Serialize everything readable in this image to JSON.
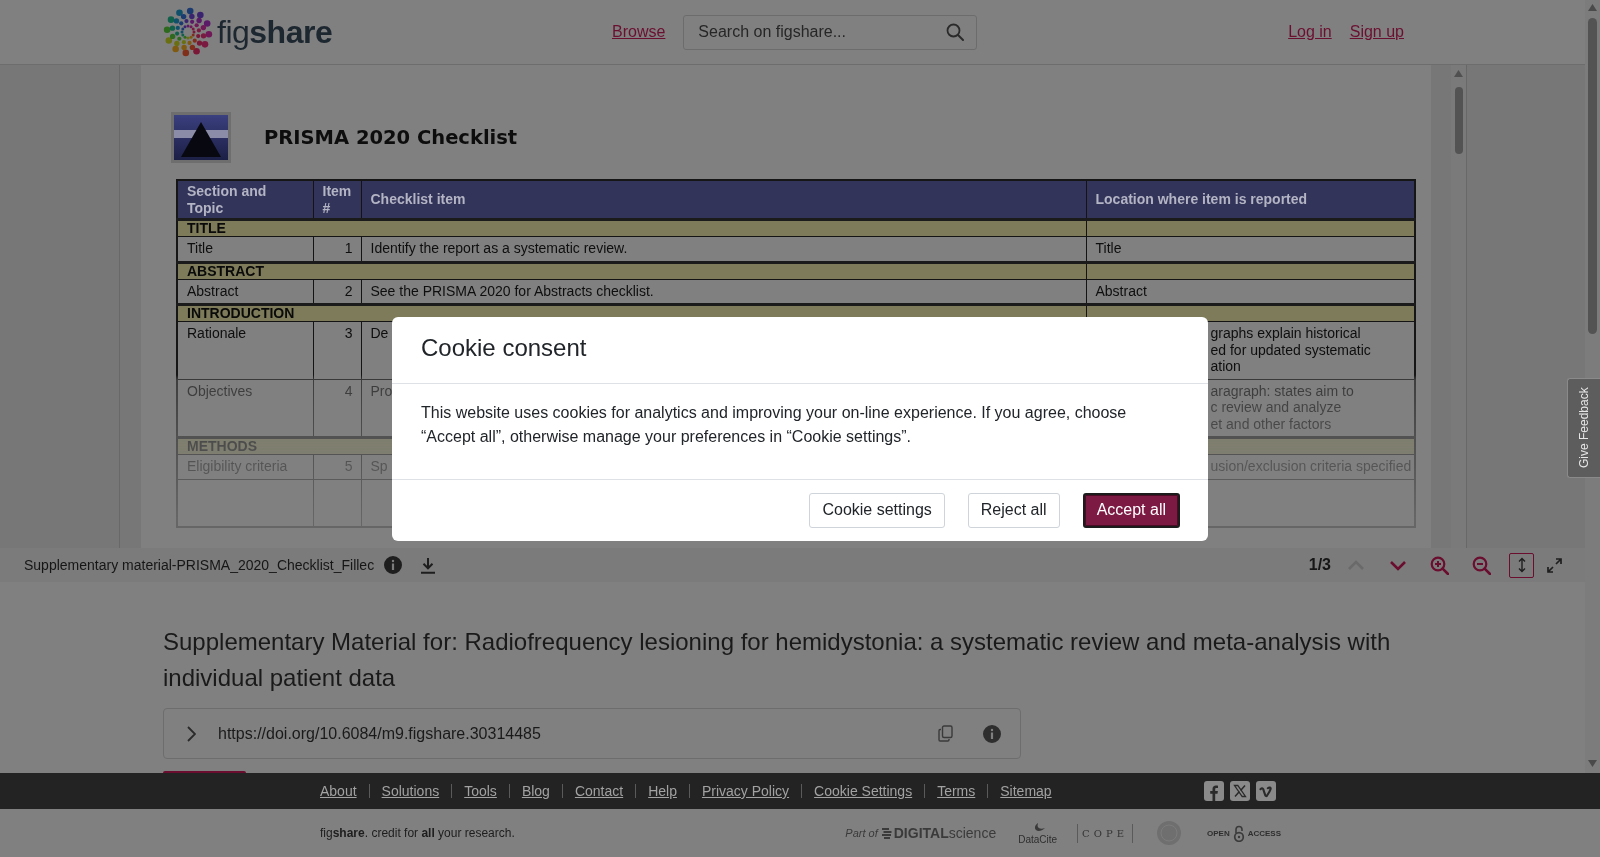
{
  "header": {
    "logo_text": "fig**share**",
    "browse_link": "Browse",
    "search": {
      "placeholder": "Search on figshare..."
    },
    "account_links": [
      "Log in",
      "Sign up"
    ]
  },
  "preview": {
    "document": {
      "title": "PRISMA 2020 Checklist",
      "table": {
        "columns": [
          "Section and Topic",
          "Item #",
          "Checklist item",
          "Location where item is reported"
        ],
        "rows": [
          {
            "kind": "section",
            "label": "TITLE"
          },
          {
            "kind": "item",
            "cells": [
              "Title",
              "1",
              "Identify the report as a systematic review.",
              "Title"
            ]
          },
          {
            "kind": "section",
            "label": "ABSTRACT"
          },
          {
            "kind": "item",
            "cells": [
              "Abstract",
              "2",
              "See the PRISMA 2020 for Abstracts checklist.",
              "Abstract"
            ]
          },
          {
            "kind": "section",
            "label": "INTRODUCTION"
          },
          {
            "kind": "item",
            "cells": [
              "Rationale",
              "3",
              "De",
              "graphs explain historical\ned for updated systematic\nation"
            ]
          },
          {
            "kind": "item",
            "cells": [
              "Objectives",
              "4",
              "Pro",
              "aragraph: states aim to\nc review and analyze\net and other factors"
            ]
          },
          {
            "kind": "section",
            "label": "METHODS"
          },
          {
            "kind": "item",
            "cells": [
              "Eligibility criteria",
              "5",
              "Sp",
              "usion/exclusion criteria specified"
            ]
          },
          {
            "kind": "illegible"
          }
        ]
      }
    },
    "toolbar": {
      "file_name": "Supplementary material-PRISMA_2020_Checklist_Fillec",
      "page_indicator": "1/3",
      "page_nav": [
        {
          "kind": "previous",
          "disabled": true
        },
        {
          "kind": "next",
          "disabled": false
        }
      ],
      "zoom": [
        {
          "kind": "in"
        },
        {
          "kind": "out"
        }
      ],
      "view_modes": [
        {
          "kind": "fit_height",
          "selected": true
        },
        {
          "kind": "fullscreen",
          "selected": false
        }
      ]
    }
  },
  "item": {
    "title": "Supplementary Material for: Radiofrequency lesioning for hemidystonia: a systematic review and meta-analysis with individual patient data",
    "doi": "https://doi.org/10.6084/m9.figshare.30314485"
  },
  "footer": {
    "links": [
      "About",
      "Solutions",
      "Tools",
      "Blog",
      "Contact",
      "Help",
      "Privacy Policy",
      "Cookie Settings",
      "Terms",
      "Sitemap"
    ],
    "tagline": "fig**share**. credit for **all** your research.",
    "partners": [
      {
        "kind": "digital_science",
        "prefix": "Part of",
        "text": "**DIGITAL**science"
      },
      {
        "kind": "datacite",
        "text": "DataCite"
      },
      {
        "kind": "cope",
        "text": "COPE"
      },
      {
        "kind": "seal"
      },
      {
        "kind": "open_access",
        "texts": [
          "OPEN",
          "ACCESS"
        ]
      }
    ]
  },
  "feedback_tab": "Give Feedback",
  "cookie_dialog": {
    "title": "Cookie consent",
    "message": "This website uses cookies for analytics and improving your on-line experience. If you agree, choose “Accept all”, otherwise manage your preferences in “Cookie settings”.",
    "buttons": [
      {
        "label": "Cookie settings",
        "kind": "secondary",
        "focused": false
      },
      {
        "label": "Reject all",
        "kind": "secondary",
        "focused": false
      },
      {
        "label": "Accept all",
        "kind": "primary",
        "focused": true
      }
    ]
  }
}
